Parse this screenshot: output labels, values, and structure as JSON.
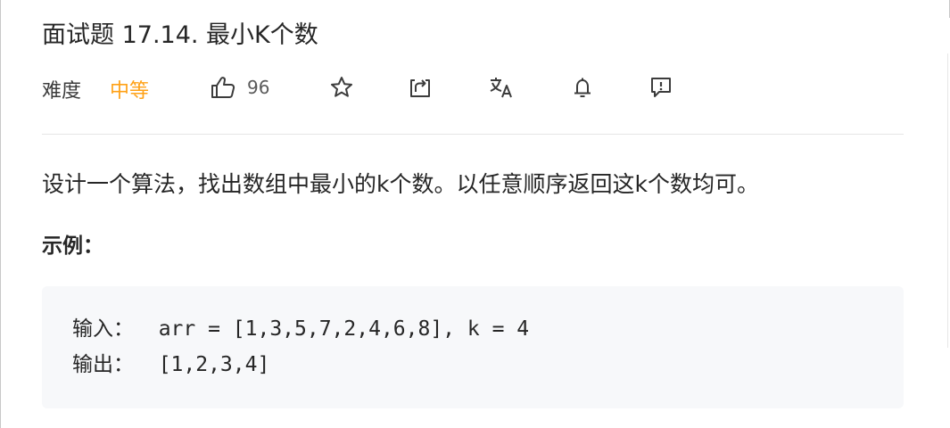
{
  "problem": {
    "title": "面试题 17.14. 最小K个数",
    "difficulty_label": "难度",
    "difficulty": "中等",
    "likes": "96",
    "description": "设计一个算法，找出数组中最小的k个数。以任意顺序返回这k个数均可。",
    "example_heading": "示例："
  },
  "example": {
    "input_label": "输入：",
    "input_value": "  arr = [1,3,5,7,2,4,6,8], k = 4",
    "output_label": "输出：",
    "output_value": "  [1,2,3,4]"
  },
  "icons": {
    "like": "thumbs-up-icon",
    "favorite": "star-icon",
    "share": "share-icon",
    "translate": "translate-icon",
    "notify": "bell-icon",
    "feedback": "feedback-icon"
  },
  "colors": {
    "difficulty_medium": "#ffa116",
    "code_background": "#f7f8fa",
    "divider": "#e5e5e5"
  }
}
